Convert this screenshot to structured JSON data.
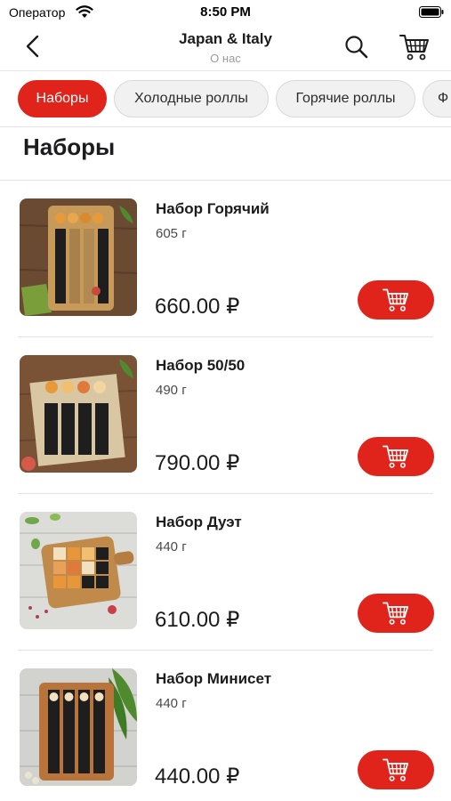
{
  "status_bar": {
    "carrier": "Оператор",
    "time": "8:50 PM"
  },
  "nav": {
    "title": "Japan & Italy",
    "subtitle": "О нас",
    "icons": [
      "chevron-left-icon",
      "search-icon",
      "cart-icon"
    ]
  },
  "tabs": [
    {
      "label": "Наборы",
      "active": true
    },
    {
      "label": "Холодные роллы",
      "active": false
    },
    {
      "label": "Горячие роллы",
      "active": false
    },
    {
      "label": "Ф",
      "active": false
    }
  ],
  "section": {
    "title": "Наборы"
  },
  "products": [
    {
      "name": "Набор Горячий",
      "weight": "605 г",
      "price": "660.00 ₽",
      "image": "sushi-set-photo"
    },
    {
      "name": "Набор 50/50",
      "weight": "490 г",
      "price": "790.00 ₽",
      "image": "sushi-set-photo"
    },
    {
      "name": "Набор Дуэт",
      "weight": "440 г",
      "price": "610.00 ₽",
      "image": "sushi-set-photo"
    },
    {
      "name": "Набор Минисет",
      "weight": "440 г",
      "price": "440.00 ₽",
      "image": "sushi-set-photo"
    }
  ],
  "colors": {
    "accent": "#e0241b",
    "tab_inactive_bg": "#f1f1f2",
    "divider": "#e4e4e6"
  }
}
